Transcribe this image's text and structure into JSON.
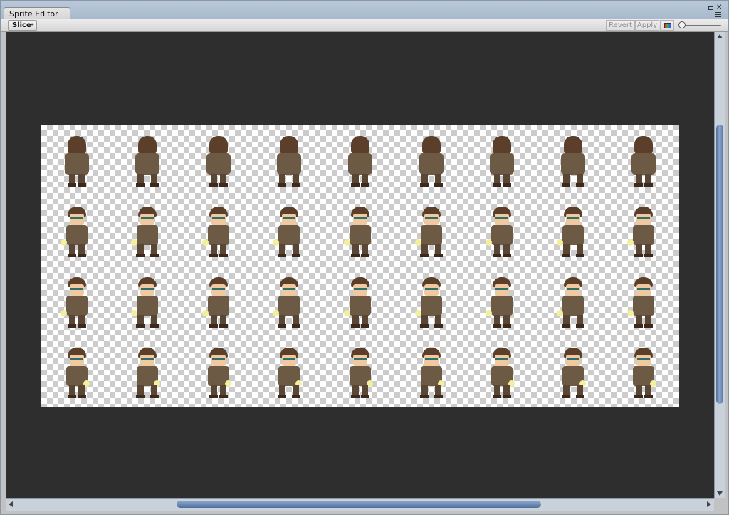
{
  "window": {
    "tab_title": "Sprite Editor"
  },
  "toolbar": {
    "slice_label": "Slice",
    "slice_arrow": "÷",
    "revert_label": "Revert",
    "apply_label": "Apply",
    "color_channel_icon": "rgb-channel-icon",
    "zoom_level": 0.0
  },
  "sprite_sheet": {
    "rows": 4,
    "columns": 9,
    "row_facing": [
      "back",
      "left",
      "front",
      "right"
    ],
    "accent_colors": {
      "hair": "#5c3f2b",
      "skin": "#f0c9a0",
      "coat": "#6c5a44",
      "flash": "#f3ef9a"
    }
  },
  "colors": {
    "viewport_bg": "#2e2e2e",
    "scroll_thumb": "#6a86b4"
  },
  "window_buttons": {
    "maximize_icon": "maximize-icon",
    "close_icon": "close-icon",
    "menu_icon": "window-menu-icon"
  }
}
